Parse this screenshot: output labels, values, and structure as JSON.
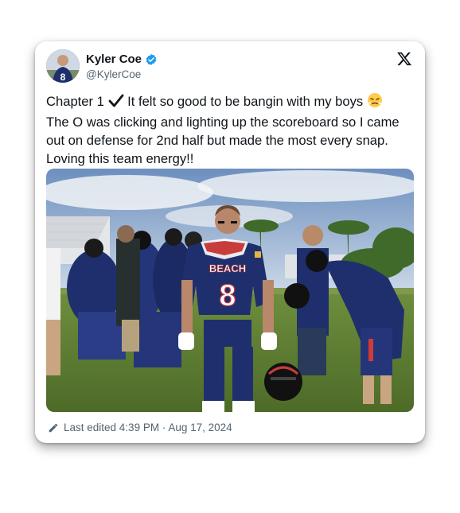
{
  "author": {
    "name": "Kyler Coe",
    "handle": "@KylerCoe",
    "verified": true,
    "avatar_jersey_number": "8"
  },
  "tweet": {
    "text_before_check": "Chapter 1",
    "text_after_check": "It felt so good to be bangin with my boys",
    "text_body": "The O was clicking and lighting up the scoreboard so I came out on defense for 2nd half but made the most every snap. Loving this team energy!!"
  },
  "photo": {
    "jersey_wordmark": "BEACH",
    "jersey_number": "8"
  },
  "footer": {
    "edited_label": "Last edited 4:39 PM · Aug 17, 2024"
  },
  "colors": {
    "verified_blue": "#1d9bf0",
    "text": "#0f1419",
    "secondary_text": "#536471",
    "jersey_navy": "#1f2f6e"
  },
  "icons": [
    "verified-badge-icon",
    "x-logo-icon",
    "checkmark-icon",
    "steaming-face-emoji-icon",
    "pencil-icon"
  ]
}
